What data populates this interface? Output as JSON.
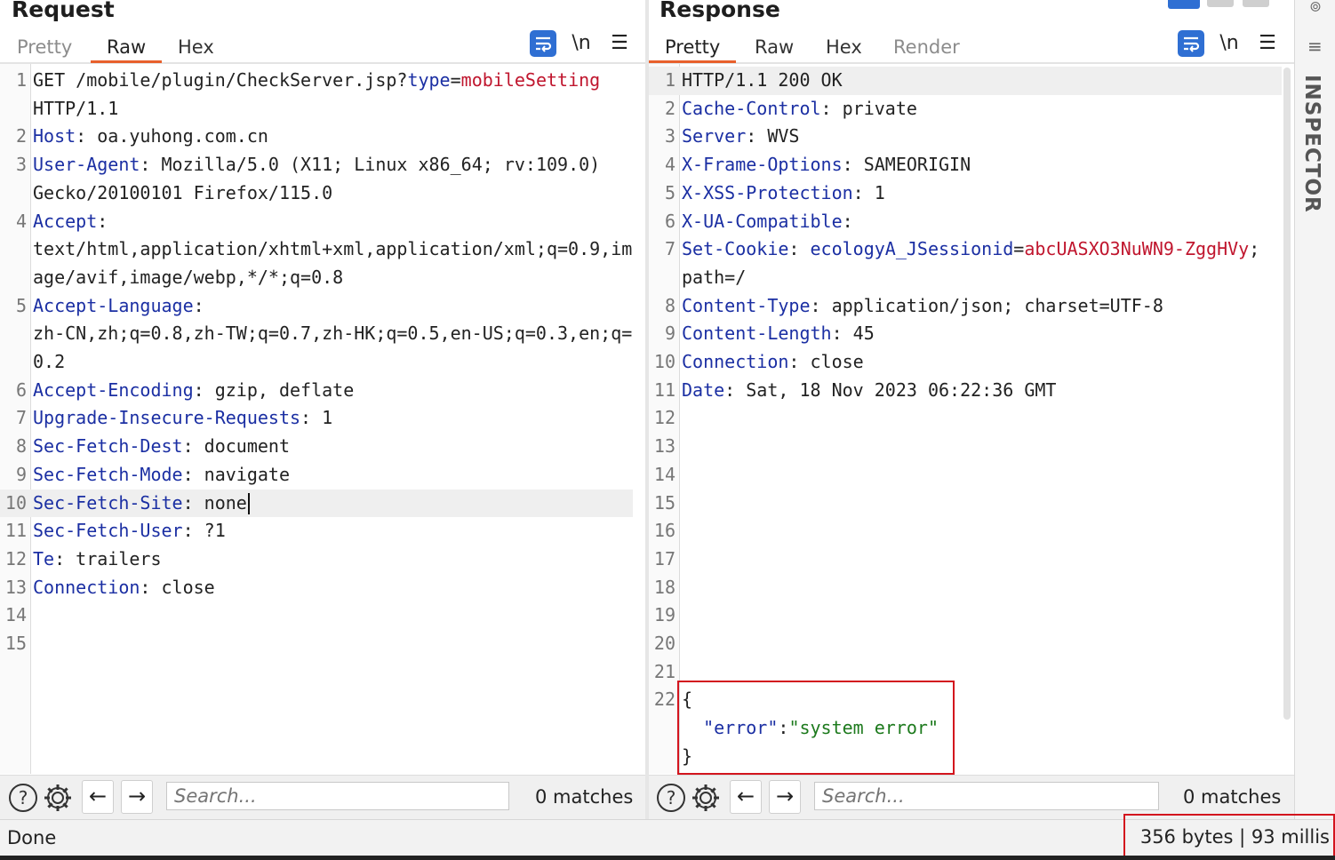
{
  "request": {
    "title": "Request",
    "tabs": [
      "Pretty",
      "Raw",
      "Hex"
    ],
    "active_tab": "Raw",
    "newline_toggle": "\\n",
    "lines": [
      {
        "n": "1",
        "seg": [
          [
            "GET /mobile/plugin/CheckServer.jsp?",
            ""
          ],
          [
            "type",
            "k"
          ],
          [
            "=",
            ""
          ],
          [
            "mobileSetting",
            "v"
          ]
        ]
      },
      {
        "n": "",
        "seg": [
          [
            "HTTP/1.1",
            ""
          ]
        ]
      },
      {
        "n": "2",
        "seg": [
          [
            "Host",
            "k"
          ],
          [
            ": oa.yuhong.com.cn",
            ""
          ]
        ]
      },
      {
        "n": "3",
        "seg": [
          [
            "User-Agent",
            "k"
          ],
          [
            ": Mozilla/5.0 (X11; Linux x86_64; rv:109.0)",
            ""
          ]
        ]
      },
      {
        "n": "",
        "seg": [
          [
            "Gecko/20100101 Firefox/115.0",
            ""
          ]
        ]
      },
      {
        "n": "4",
        "seg": [
          [
            "Accept",
            "k"
          ],
          [
            ":",
            ""
          ]
        ]
      },
      {
        "n": "",
        "seg": [
          [
            "text/html,application/xhtml+xml,application/xml;q=0.9,im",
            ""
          ]
        ]
      },
      {
        "n": "",
        "seg": [
          [
            "age/avif,image/webp,*/*;q=0.8",
            ""
          ]
        ]
      },
      {
        "n": "5",
        "seg": [
          [
            "Accept-Language",
            "k"
          ],
          [
            ":",
            ""
          ]
        ]
      },
      {
        "n": "",
        "seg": [
          [
            "zh-CN,zh;q=0.8,zh-TW;q=0.7,zh-HK;q=0.5,en-US;q=0.3,en;q=",
            ""
          ]
        ]
      },
      {
        "n": "",
        "seg": [
          [
            "0.2",
            ""
          ]
        ]
      },
      {
        "n": "6",
        "seg": [
          [
            "Accept-Encoding",
            "k"
          ],
          [
            ": gzip, deflate",
            ""
          ]
        ]
      },
      {
        "n": "7",
        "seg": [
          [
            "Upgrade-Insecure-Requests",
            "k"
          ],
          [
            ": 1",
            ""
          ]
        ]
      },
      {
        "n": "8",
        "seg": [
          [
            "Sec-Fetch-Dest",
            "k"
          ],
          [
            ": document",
            ""
          ]
        ]
      },
      {
        "n": "9",
        "seg": [
          [
            "Sec-Fetch-Mode",
            "k"
          ],
          [
            ": navigate",
            ""
          ]
        ]
      },
      {
        "n": "10",
        "seg": [
          [
            "Sec-Fetch-Site",
            "k"
          ],
          [
            ": none",
            ""
          ]
        ],
        "highlight": true
      },
      {
        "n": "11",
        "seg": [
          [
            "Sec-Fetch-User",
            "k"
          ],
          [
            ": ?1",
            ""
          ]
        ]
      },
      {
        "n": "12",
        "seg": [
          [
            "Te",
            "k"
          ],
          [
            ": trailers",
            ""
          ]
        ]
      },
      {
        "n": "13",
        "seg": [
          [
            "Connection",
            "k"
          ],
          [
            ": close",
            ""
          ]
        ]
      },
      {
        "n": "14",
        "seg": []
      },
      {
        "n": "15",
        "seg": []
      }
    ],
    "search_placeholder": "Search...",
    "matches": "0 matches"
  },
  "response": {
    "title": "Response",
    "tabs": [
      "Pretty",
      "Raw",
      "Hex",
      "Render"
    ],
    "active_tab": "Pretty",
    "newline_toggle": "\\n",
    "lines": [
      {
        "n": "1",
        "seg": [
          [
            "HTTP/1.1 200 OK",
            ""
          ]
        ],
        "highlight": true
      },
      {
        "n": "2",
        "seg": [
          [
            "Cache-Control",
            "k"
          ],
          [
            ": private",
            ""
          ]
        ]
      },
      {
        "n": "3",
        "seg": [
          [
            "Server",
            "k"
          ],
          [
            ": WVS",
            ""
          ]
        ]
      },
      {
        "n": "4",
        "seg": [
          [
            "X-Frame-Options",
            "k"
          ],
          [
            ": SAMEORIGIN",
            ""
          ]
        ]
      },
      {
        "n": "5",
        "seg": [
          [
            "X-XSS-Protection",
            "k"
          ],
          [
            ": 1",
            ""
          ]
        ]
      },
      {
        "n": "6",
        "seg": [
          [
            "X-UA-Compatible",
            "k"
          ],
          [
            ":",
            ""
          ]
        ]
      },
      {
        "n": "7",
        "seg": [
          [
            "Set-Cookie",
            "k"
          ],
          [
            ": ",
            ""
          ],
          [
            "ecologyA_JSessionid",
            "k"
          ],
          [
            "=",
            ""
          ],
          [
            "abcUASXO3NuWN9-ZggHVy",
            "v"
          ],
          [
            ";",
            ""
          ]
        ]
      },
      {
        "n": "",
        "seg": [
          [
            "path=/",
            ""
          ]
        ]
      },
      {
        "n": "8",
        "seg": [
          [
            "Content-Type",
            "k"
          ],
          [
            ": application/json; charset=UTF-8",
            ""
          ]
        ]
      },
      {
        "n": "9",
        "seg": [
          [
            "Content-Length",
            "k"
          ],
          [
            ": 45",
            ""
          ]
        ]
      },
      {
        "n": "10",
        "seg": [
          [
            "Connection",
            "k"
          ],
          [
            ": close",
            ""
          ]
        ]
      },
      {
        "n": "11",
        "seg": [
          [
            "Date",
            "k"
          ],
          [
            ": Sat, 18 Nov 2023 06:22:36 GMT",
            ""
          ]
        ]
      },
      {
        "n": "12",
        "seg": []
      },
      {
        "n": "13",
        "seg": []
      },
      {
        "n": "14",
        "seg": []
      },
      {
        "n": "15",
        "seg": []
      },
      {
        "n": "16",
        "seg": []
      },
      {
        "n": "17",
        "seg": []
      },
      {
        "n": "18",
        "seg": []
      },
      {
        "n": "19",
        "seg": []
      },
      {
        "n": "20",
        "seg": []
      },
      {
        "n": "21",
        "seg": []
      },
      {
        "n": "22",
        "seg": [
          [
            "{",
            ""
          ]
        ]
      },
      {
        "n": "",
        "seg": [
          [
            "  ",
            ""
          ],
          [
            "\"error\"",
            "k"
          ],
          [
            ":",
            ""
          ],
          [
            "\"system error\"",
            "s"
          ]
        ]
      },
      {
        "n": "",
        "seg": [
          [
            "}",
            ""
          ]
        ]
      }
    ],
    "search_placeholder": "Search...",
    "matches": "0 matches"
  },
  "inspector_label": "INSPECTOR",
  "status": {
    "left": "Done",
    "right": "356 bytes | 93 millis"
  },
  "colors": {
    "accent_tab": "#e8602c",
    "highlight_box": "#d3151e",
    "header_name": "#1b2fa3",
    "value_red": "#c0162e",
    "string_green": "#1d7a1d",
    "wrap_button": "#2f6fd3"
  }
}
